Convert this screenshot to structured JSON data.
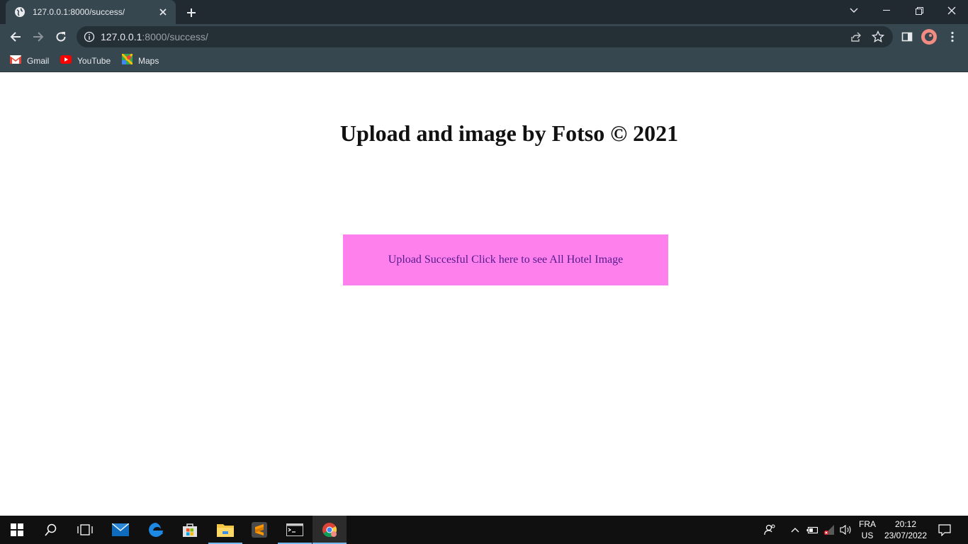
{
  "browser": {
    "tab": {
      "title": "127.0.0.1:8000/success/",
      "favicon": "globe-icon"
    },
    "address": {
      "host": "127.0.0.1",
      "path": ":8000/success/"
    },
    "bookmarks": [
      {
        "label": "Gmail",
        "icon": "gmail-icon"
      },
      {
        "label": "YouTube",
        "icon": "youtube-icon"
      },
      {
        "label": "Maps",
        "icon": "maps-icon"
      }
    ],
    "colors": {
      "tabstrip": "#202a30",
      "toolbar": "#37474f",
      "omnibox": "#253036"
    }
  },
  "page": {
    "title": "Upload and image by Fotso © 2021",
    "success_link": "Upload Succesful Click here to see All Hotel Image",
    "colors": {
      "box": "#fe80ed",
      "link": "#551a8b"
    }
  },
  "taskbar": {
    "apps": [
      "start-icon",
      "search-icon",
      "task-view-icon",
      "mail-icon",
      "edge-icon",
      "store-icon",
      "file-explorer-icon",
      "sublime-text-icon",
      "terminal-icon",
      "chrome-icon"
    ],
    "language": "FRA",
    "layout": "US",
    "time": "20:12",
    "date": "23/07/2022"
  }
}
